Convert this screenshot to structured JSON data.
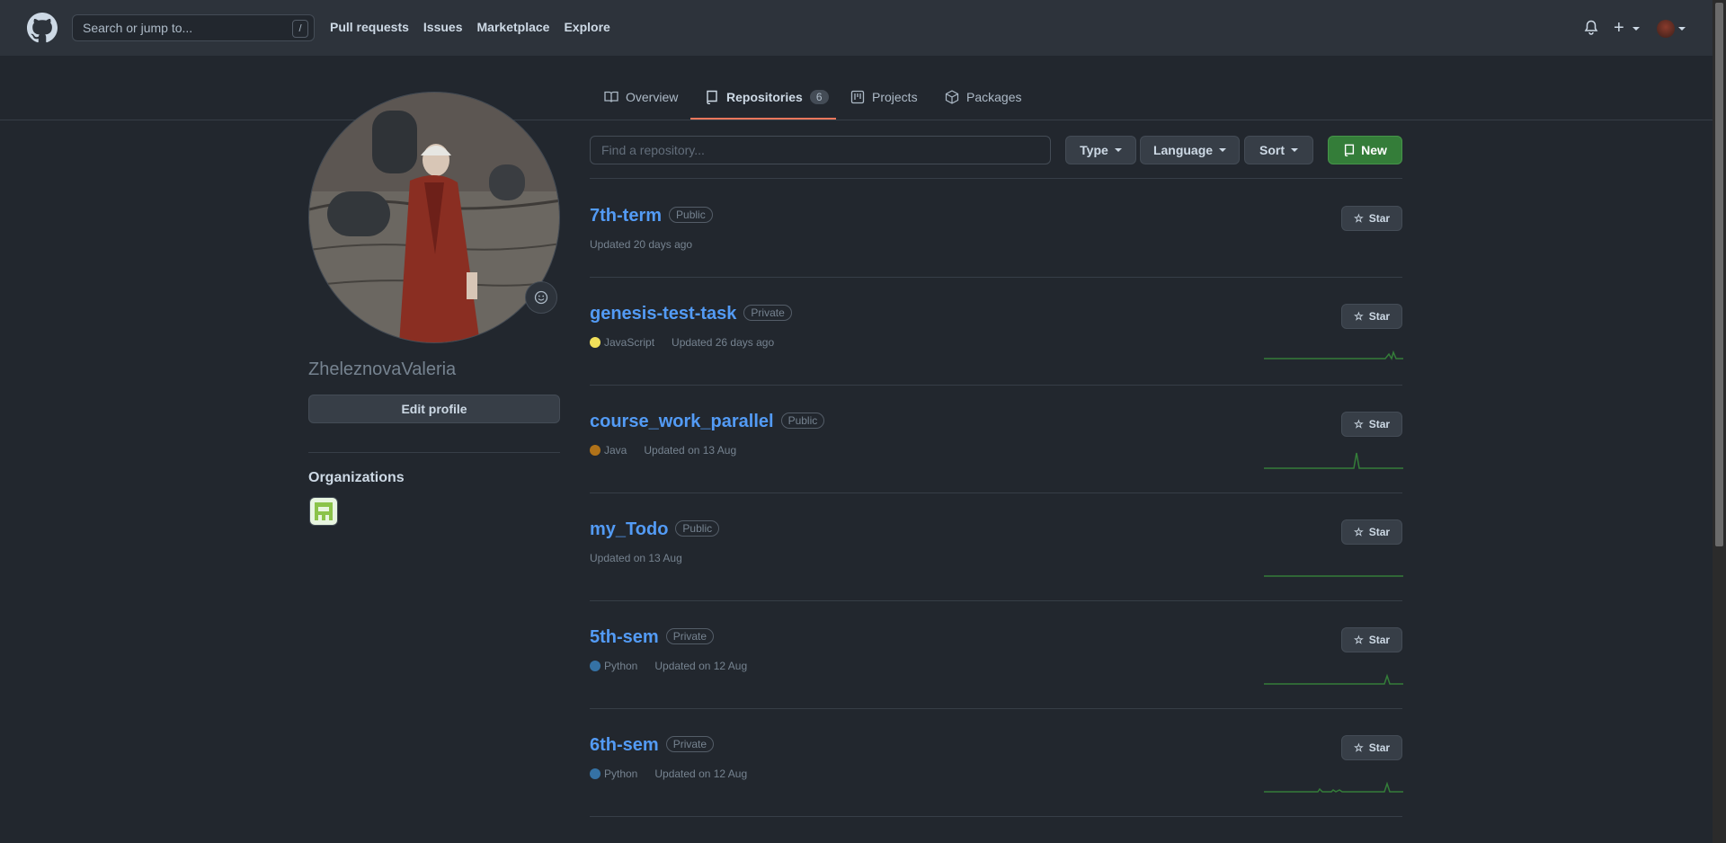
{
  "header": {
    "search_placeholder": "Search or jump to...",
    "search_shortcut": "/",
    "nav": [
      "Pull requests",
      "Issues",
      "Marketplace",
      "Explore"
    ],
    "plus_label": "+"
  },
  "tabs": [
    {
      "label": "Overview"
    },
    {
      "label": "Repositories",
      "count": "6"
    },
    {
      "label": "Projects"
    },
    {
      "label": "Packages"
    }
  ],
  "profile": {
    "username": "ZheleznovaValeria",
    "edit_label": "Edit profile",
    "organizations_title": "Organizations"
  },
  "toolbar": {
    "find_placeholder": "Find a repository...",
    "type_label": "Type",
    "language_label": "Language",
    "sort_label": "Sort",
    "new_label": "New"
  },
  "repos": [
    {
      "name": "7th-term",
      "visibility": "Public",
      "language": "",
      "lang_color": "",
      "updated": "Updated 20 days ago",
      "star": "Star"
    },
    {
      "name": "genesis-test-task",
      "visibility": "Private",
      "language": "JavaScript",
      "lang_color": "#f1e05a",
      "updated": "Updated 26 days ago",
      "star": "Star"
    },
    {
      "name": "course_work_parallel",
      "visibility": "Public",
      "language": "Java",
      "lang_color": "#b07219",
      "updated": "Updated on 13 Aug",
      "star": "Star"
    },
    {
      "name": "my_Todo",
      "visibility": "Public",
      "language": "",
      "lang_color": "",
      "updated": "Updated on 13 Aug",
      "star": "Star"
    },
    {
      "name": "5th-sem",
      "visibility": "Private",
      "language": "Python",
      "lang_color": "#3572A5",
      "updated": "Updated on 12 Aug",
      "star": "Star"
    },
    {
      "name": "6th-sem",
      "visibility": "Private",
      "language": "Python",
      "lang_color": "#3572A5",
      "updated": "Updated on 12 Aug",
      "star": "Star"
    }
  ],
  "colors": {
    "accent_link": "#539bf5",
    "new_button": "#347d39",
    "tab_underline": "#ec775c",
    "sparkline": "#347d39"
  }
}
